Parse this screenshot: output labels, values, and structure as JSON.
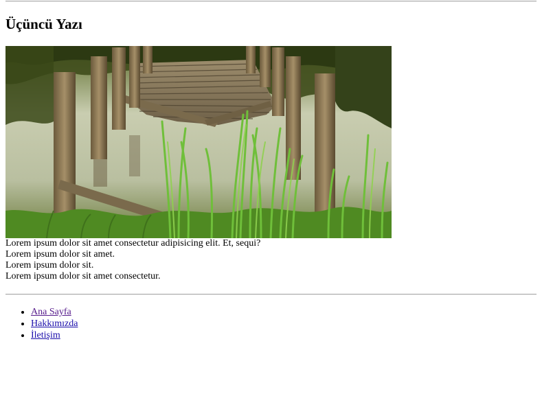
{
  "article": {
    "title": "Üçüncü Yazı",
    "image_alt": "Old broken wooden pier over a pond with tall green reeds",
    "paragraphs": [
      "Lorem ipsum dolor sit amet consectetur adipisicing elit. Et, sequi?",
      "Lorem ipsum dolor sit amet.",
      "Lorem ipsum dolor sit.",
      "Lorem ipsum dolor sit amet consectetur."
    ]
  },
  "nav": {
    "items": [
      {
        "label": "Ana Sayfa"
      },
      {
        "label": "Hakkımızda"
      },
      {
        "label": "İletişim"
      }
    ]
  },
  "colors": {
    "link": "#1a0dab",
    "link_visited": "#551a8b",
    "rule": "#a9a9a9"
  }
}
